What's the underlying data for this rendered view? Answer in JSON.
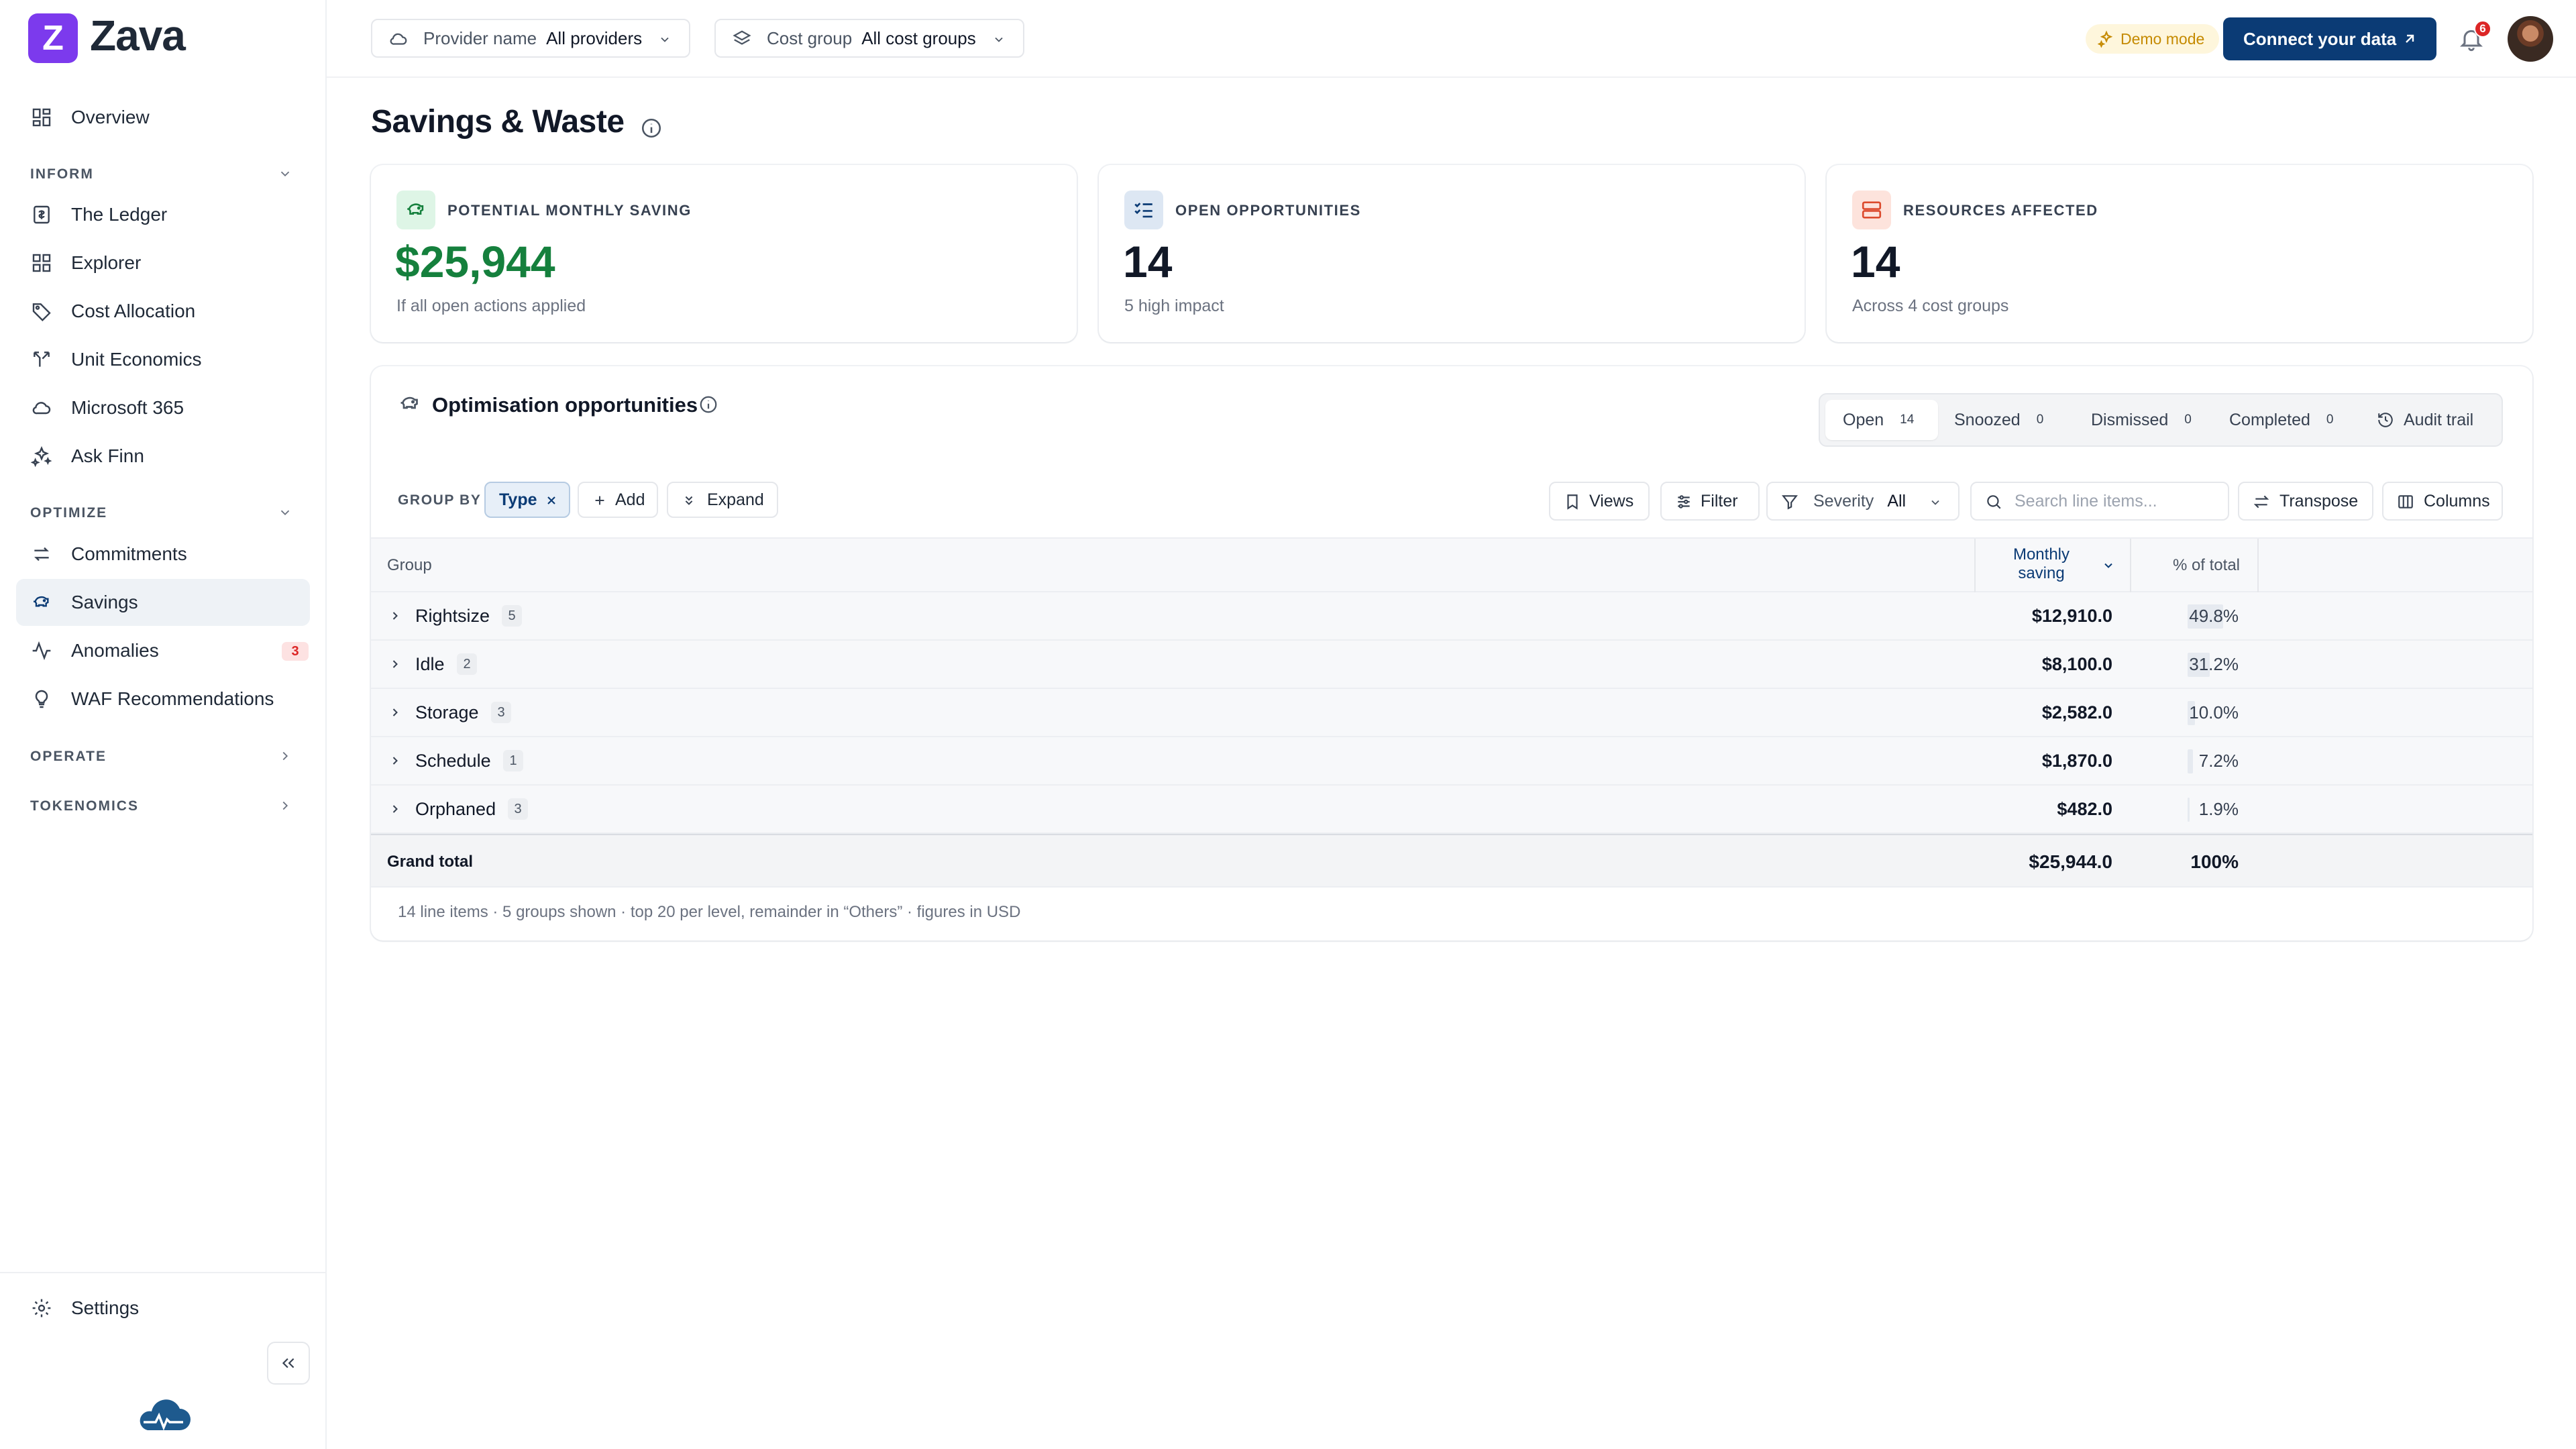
{
  "app": {
    "logo_letter": "Z",
    "name": "Zava"
  },
  "sidebar": {
    "overview": "Overview",
    "sections": {
      "inform": "INFORM",
      "optimize": "OPTIMIZE",
      "operate": "OPERATE",
      "tokenomics": "TOKENOMICS"
    },
    "inform_items": [
      "The Ledger",
      "Explorer",
      "Cost Allocation",
      "Unit Economics",
      "Microsoft 365",
      "Ask Finn"
    ],
    "optimize_items": [
      "Commitments",
      "Savings",
      "Anomalies",
      "WAF Recommendations"
    ],
    "active_item": "Savings",
    "anomalies_badge": "3",
    "settings": "Settings"
  },
  "header": {
    "provider_filter": {
      "key": "Provider name",
      "value": "All providers"
    },
    "cost_group_filter": {
      "key": "Cost group",
      "value": "All cost groups"
    },
    "demo_mode": "Demo mode",
    "connect_button": "Connect your data",
    "notification_count": "6"
  },
  "page": {
    "title": "Savings & Waste"
  },
  "kpis": [
    {
      "label": "POTENTIAL MONTHLY SAVING",
      "value": "$25,944",
      "sub": "If all open actions applied",
      "value_color": "#15803d"
    },
    {
      "label": "OPEN OPPORTUNITIES",
      "value": "14",
      "sub": "5 high impact"
    },
    {
      "label": "RESOURCES AFFECTED",
      "value": "14",
      "sub": "Across 4 cost groups"
    }
  ],
  "panel": {
    "title": "Optimisation opportunities",
    "status_tabs": [
      {
        "label": "Open",
        "count": "14"
      },
      {
        "label": "Snoozed",
        "count": "0"
      },
      {
        "label": "Dismissed",
        "count": "0"
      },
      {
        "label": "Completed",
        "count": "0"
      }
    ],
    "audit_trail": "Audit trail",
    "group_by_label": "GROUP BY",
    "group_by_chip": "Type",
    "add_label": "Add",
    "expand_label": "Expand",
    "toolbar": {
      "views": "Views",
      "filter": "Filter",
      "severity_key": "Severity",
      "severity_value": "All",
      "search_placeholder": "Search line items...",
      "transpose": "Transpose",
      "columns": "Columns"
    },
    "table": {
      "col_group": "Group",
      "col_saving_line1": "Monthly",
      "col_saving_line2": "saving",
      "col_pct": "% of total",
      "rows": [
        {
          "name": "Rightsize",
          "count": "5",
          "amount": "$12,910.0",
          "pct": "49.8%",
          "pct_value": 49.8
        },
        {
          "name": "Idle",
          "count": "2",
          "amount": "$8,100.0",
          "pct": "31.2%",
          "pct_value": 31.2
        },
        {
          "name": "Storage",
          "count": "3",
          "amount": "$2,582.0",
          "pct": "10.0%",
          "pct_value": 10.0
        },
        {
          "name": "Schedule",
          "count": "1",
          "amount": "$1,870.0",
          "pct": "7.2%",
          "pct_value": 7.2
        },
        {
          "name": "Orphaned",
          "count": "3",
          "amount": "$482.0",
          "pct": "1.9%",
          "pct_value": 1.9
        }
      ],
      "total_label": "Grand total",
      "total_amount": "$25,944.0",
      "total_pct": "100%"
    },
    "footnote": "14 line items · 5 groups shown · top 20 per level, remainder in “Others” · figures in USD"
  },
  "colors": {
    "brand": "#7c3aed",
    "primary_button": "#0b3b75",
    "saving_green": "#15803d",
    "badge_red": "#dc2626"
  }
}
